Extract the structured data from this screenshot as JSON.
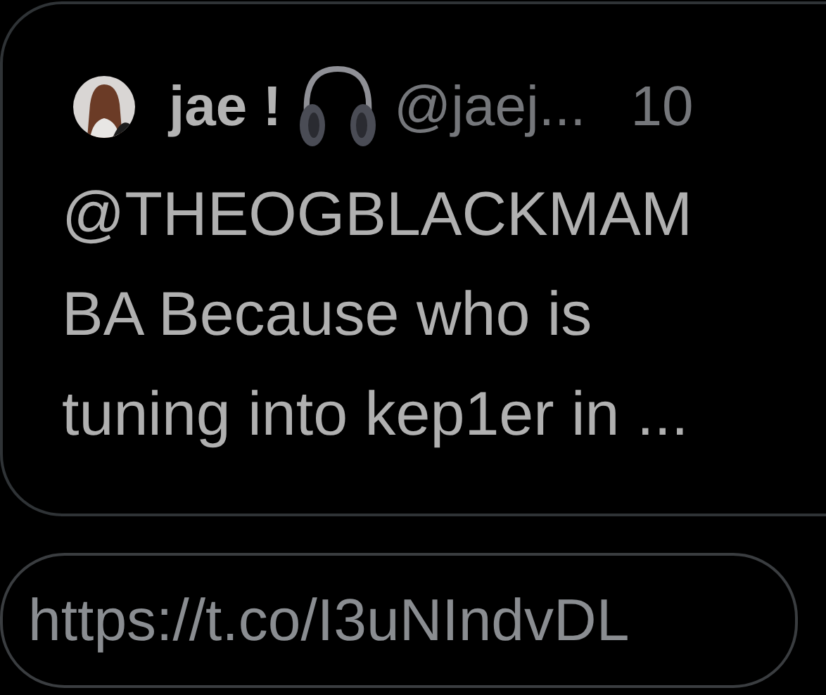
{
  "quoted_tweet": {
    "author": {
      "name": "jae !",
      "handle": "@jaej...",
      "time": "10"
    },
    "text_lines": [
      "@THEOGBLACKMAM",
      "BA Because who is",
      "tuning into kep1er in ..."
    ]
  },
  "link": {
    "url": "https://t.co/I3uNIndvDL"
  }
}
